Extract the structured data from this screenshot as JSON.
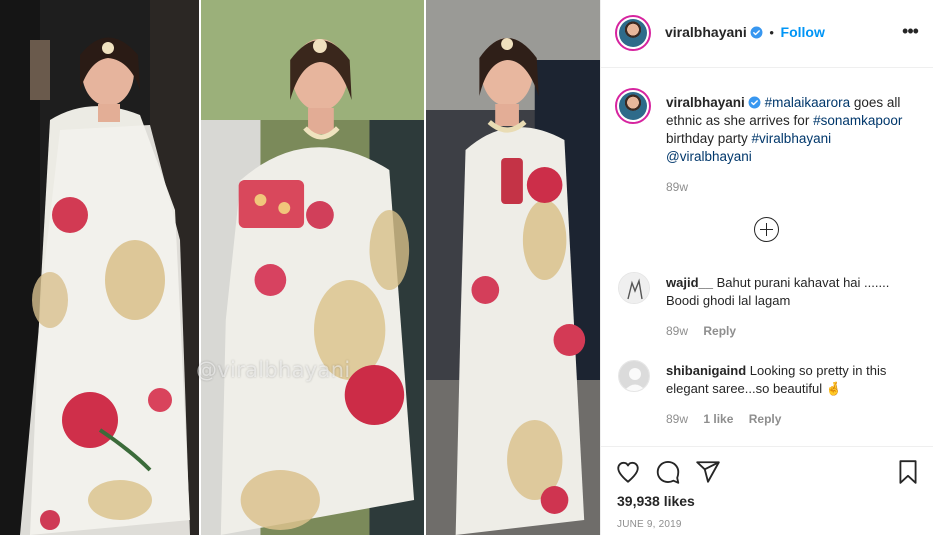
{
  "post": {
    "watermark": "@viralbhayani",
    "photo_alt": "Malaika Arora in white floral saree - three shot collage"
  },
  "header": {
    "username": "viralbhayani",
    "separator": "•",
    "follow_label": "Follow",
    "more_label": "•••"
  },
  "caption": {
    "username": "viralbhayani",
    "parts": [
      {
        "type": "tag",
        "text": "#malaikaarora"
      },
      {
        "type": "text",
        "text": " goes all ethnic as she arrives for "
      },
      {
        "type": "tag",
        "text": "#sonamkapoor"
      },
      {
        "type": "text",
        "text": " birthday party "
      },
      {
        "type": "tag",
        "text": "#viralbhayani"
      },
      {
        "type": "text",
        "text": " "
      },
      {
        "type": "tag",
        "text": "@viralbhayani"
      }
    ],
    "time": "89w"
  },
  "comments": [
    {
      "username": "wajid__",
      "text": "Bahut purani kahavat hai ....... Boodi ghodi lal lagam",
      "time": "89w",
      "likes": "",
      "reply_label": "Reply"
    },
    {
      "username": "shibanigaind",
      "text": "Looking so pretty in this elegant saree...so beautiful 🤞",
      "time": "89w",
      "likes": "1 like",
      "reply_label": "Reply"
    }
  ],
  "footer": {
    "likes": "39,938 likes",
    "date": "June 9, 2019"
  },
  "colors": {
    "accent": "#0095f6",
    "hashtag": "#00376b",
    "muted": "#8e8e8e",
    "text": "#262626",
    "verified": "#3897f0"
  },
  "icons": [
    "more-icon",
    "verified-icon",
    "load-more-icon",
    "heart-icon",
    "comment-icon",
    "share-icon",
    "save-icon"
  ]
}
